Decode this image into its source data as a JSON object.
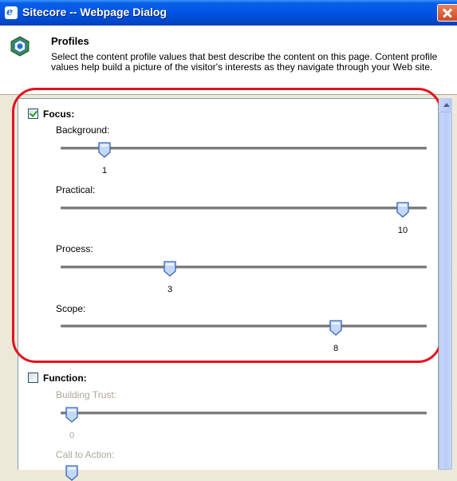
{
  "window": {
    "title": "Sitecore -- Webpage Dialog",
    "title_icon": "ie-icon",
    "close_icon": "close-icon"
  },
  "header": {
    "title": "Profiles",
    "icon": "profiles-icon",
    "description": "Select the content profile values that best describe the content on this page. Content profile values help build a picture of the visitor's interests as they navigate through your Web site."
  },
  "profiles": [
    {
      "name": "Focus:",
      "checked": true,
      "sliders": [
        {
          "label": "Background:",
          "value": "1",
          "position": 0.1
        },
        {
          "label": "Practical:",
          "value": "10",
          "position": 1.0
        },
        {
          "label": "Process:",
          "value": "3",
          "position": 0.3
        },
        {
          "label": "Scope:",
          "value": "8",
          "position": 0.8
        }
      ]
    },
    {
      "name": "Function:",
      "checked": false,
      "sliders": [
        {
          "label": "Building Trust:",
          "value": "0",
          "position": 0.0
        },
        {
          "label": "Call to Action:",
          "value": "",
          "position": 0.0
        }
      ]
    }
  ],
  "colors": {
    "highlight": "#e3121f",
    "title_bar": "#0054e3"
  }
}
